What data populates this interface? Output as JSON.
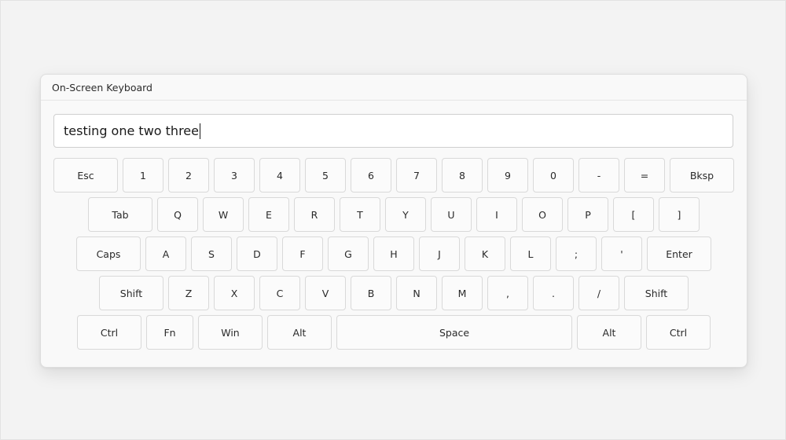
{
  "window": {
    "title": "On-Screen Keyboard"
  },
  "input": {
    "value": "testing one two three"
  },
  "keyboard": {
    "rows": [
      {
        "keys": [
          {
            "id": "esc",
            "label": "Esc"
          },
          {
            "id": "1",
            "label": "1"
          },
          {
            "id": "2",
            "label": "2"
          },
          {
            "id": "3",
            "label": "3"
          },
          {
            "id": "4",
            "label": "4"
          },
          {
            "id": "5",
            "label": "5"
          },
          {
            "id": "6",
            "label": "6"
          },
          {
            "id": "7",
            "label": "7"
          },
          {
            "id": "8",
            "label": "8"
          },
          {
            "id": "9",
            "label": "9"
          },
          {
            "id": "0",
            "label": "0"
          },
          {
            "id": "minus",
            "label": "-"
          },
          {
            "id": "equals",
            "label": "="
          },
          {
            "id": "bksp",
            "label": "Bksp"
          }
        ]
      },
      {
        "keys": [
          {
            "id": "tab",
            "label": "Tab"
          },
          {
            "id": "q",
            "label": "Q"
          },
          {
            "id": "w",
            "label": "W"
          },
          {
            "id": "e",
            "label": "E"
          },
          {
            "id": "r",
            "label": "R"
          },
          {
            "id": "t",
            "label": "T"
          },
          {
            "id": "y",
            "label": "Y"
          },
          {
            "id": "u",
            "label": "U"
          },
          {
            "id": "i",
            "label": "I"
          },
          {
            "id": "o",
            "label": "O"
          },
          {
            "id": "p",
            "label": "P"
          },
          {
            "id": "lbracket",
            "label": "["
          },
          {
            "id": "rbracket",
            "label": "]"
          }
        ]
      },
      {
        "keys": [
          {
            "id": "caps",
            "label": "Caps"
          },
          {
            "id": "a",
            "label": "A"
          },
          {
            "id": "s",
            "label": "S"
          },
          {
            "id": "d",
            "label": "D"
          },
          {
            "id": "f",
            "label": "F"
          },
          {
            "id": "g",
            "label": "G"
          },
          {
            "id": "h",
            "label": "H"
          },
          {
            "id": "j",
            "label": "J"
          },
          {
            "id": "k",
            "label": "K"
          },
          {
            "id": "l",
            "label": "L"
          },
          {
            "id": "semicolon",
            "label": ";"
          },
          {
            "id": "quote",
            "label": "'"
          },
          {
            "id": "enter",
            "label": "Enter"
          }
        ]
      },
      {
        "keys": [
          {
            "id": "shift-left",
            "label": "Shift"
          },
          {
            "id": "z",
            "label": "Z"
          },
          {
            "id": "x",
            "label": "X"
          },
          {
            "id": "c",
            "label": "C"
          },
          {
            "id": "v",
            "label": "V"
          },
          {
            "id": "b",
            "label": "B"
          },
          {
            "id": "n",
            "label": "N"
          },
          {
            "id": "m",
            "label": "M"
          },
          {
            "id": "comma",
            "label": ","
          },
          {
            "id": "period",
            "label": "."
          },
          {
            "id": "slash",
            "label": "/"
          },
          {
            "id": "shift-right",
            "label": "Shift"
          }
        ]
      },
      {
        "keys": [
          {
            "id": "ctrl-left",
            "label": "Ctrl"
          },
          {
            "id": "fn",
            "label": "Fn"
          },
          {
            "id": "win",
            "label": "Win"
          },
          {
            "id": "alt-left",
            "label": "Alt"
          },
          {
            "id": "space",
            "label": "Space"
          },
          {
            "id": "alt-right",
            "label": "Alt"
          },
          {
            "id": "ctrl-right",
            "label": "Ctrl"
          }
        ]
      }
    ]
  }
}
